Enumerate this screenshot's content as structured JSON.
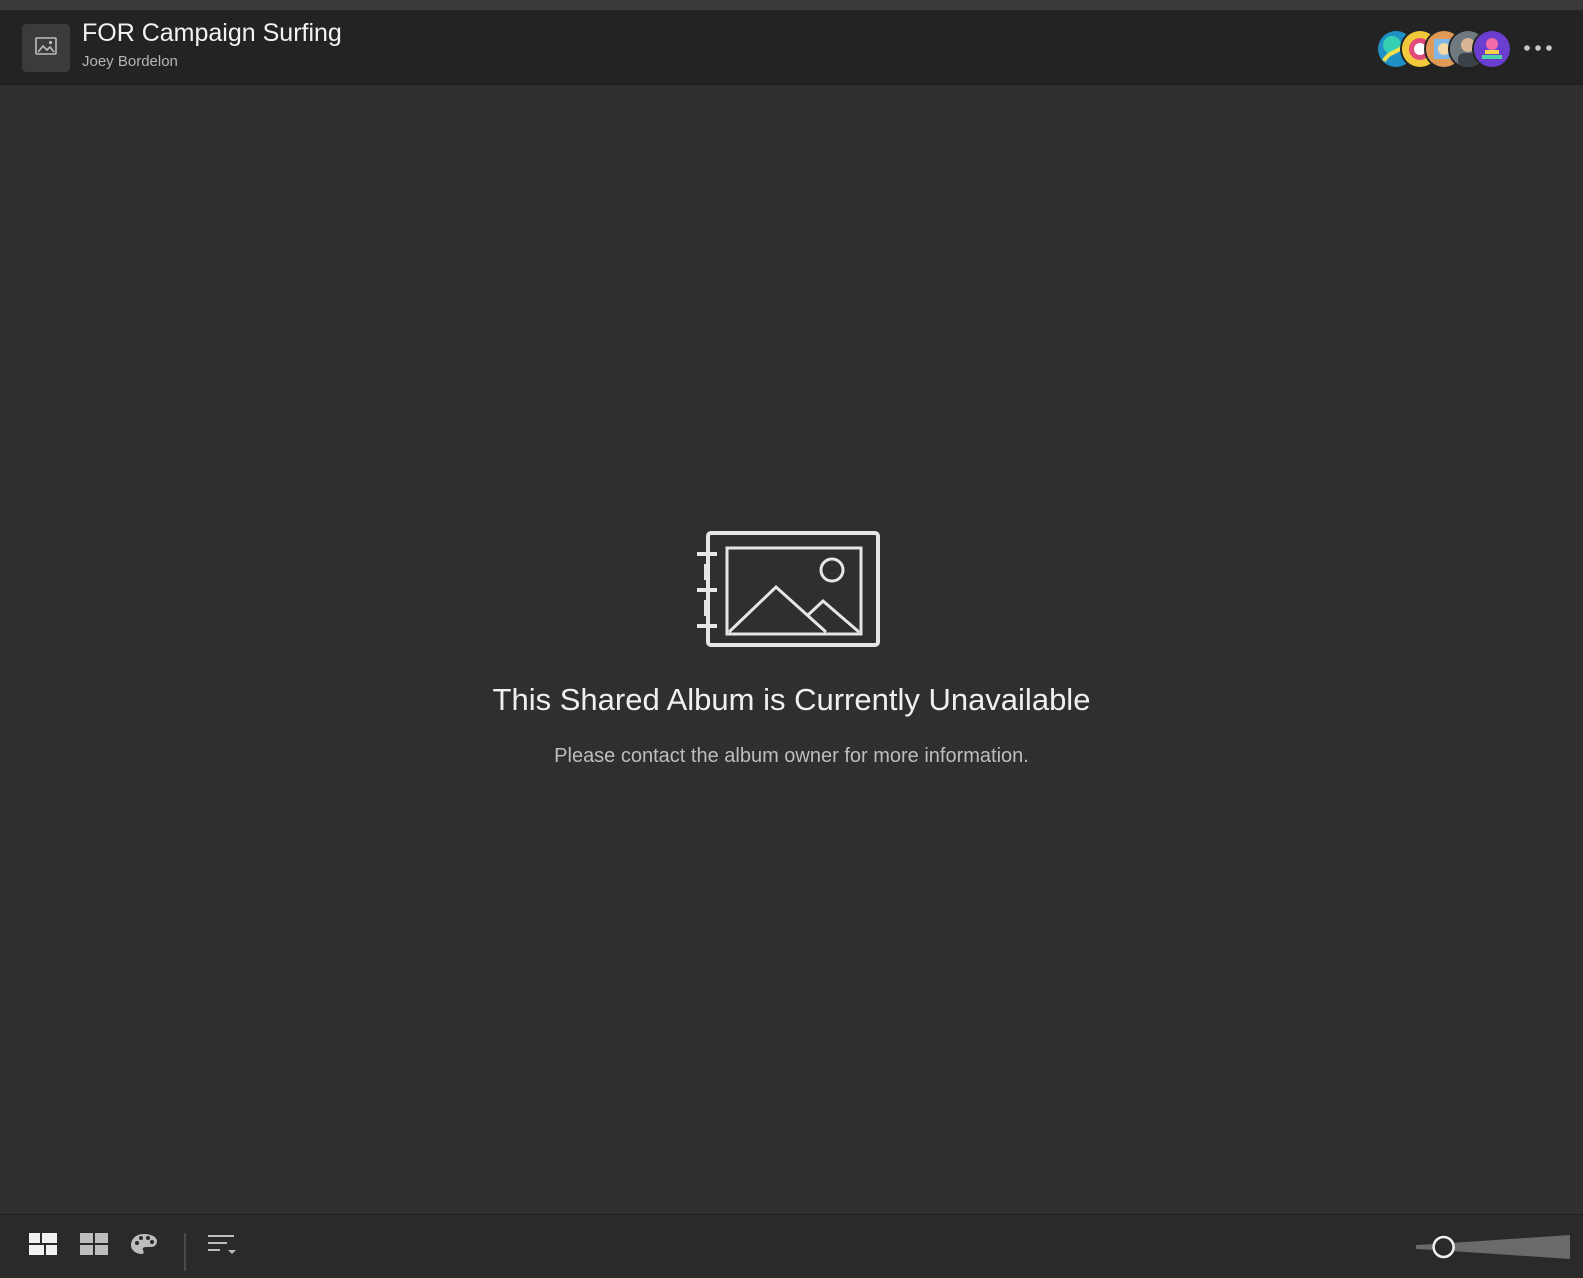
{
  "header": {
    "album_title": "FOR Campaign Surfing",
    "album_owner": "Joey Bordelon",
    "album_icon": "image-icon",
    "collaborators": [
      {
        "avatar": "collaborator-avatar-1",
        "color": "#2ea8d8"
      },
      {
        "avatar": "collaborator-avatar-2",
        "color": "#e8c53a"
      },
      {
        "avatar": "collaborator-avatar-3",
        "color": "#d9894a"
      },
      {
        "avatar": "collaborator-avatar-4",
        "color": "#8a8a8a"
      },
      {
        "avatar": "collaborator-avatar-5",
        "color": "#7a4fd0"
      }
    ],
    "more_icon": "more-horizontal-icon"
  },
  "empty_state": {
    "icon": "album-unavailable-icon",
    "title": "This Shared Album is Currently Unavailable",
    "subtitle": "Please contact the album owner for more information."
  },
  "footer": {
    "view_buttons": [
      {
        "name": "photo-grid-view-button",
        "icon": "mosaic-grid-icon",
        "selected": true
      },
      {
        "name": "square-grid-view-button",
        "icon": "square-grid-icon",
        "selected": false
      },
      {
        "name": "color-palette-view-button",
        "icon": "palette-icon",
        "selected": false
      }
    ],
    "sort_icon": "sort-icon",
    "zoom_slider_icon": "zoom-slider-icon",
    "zoom_level": 0.12
  },
  "colors": {
    "background": "#2f2f2f",
    "header_background": "#232323",
    "footer_background": "#2a2a2a",
    "text_primary": "#f2f2f2",
    "text_secondary": "#b5b5b5"
  }
}
